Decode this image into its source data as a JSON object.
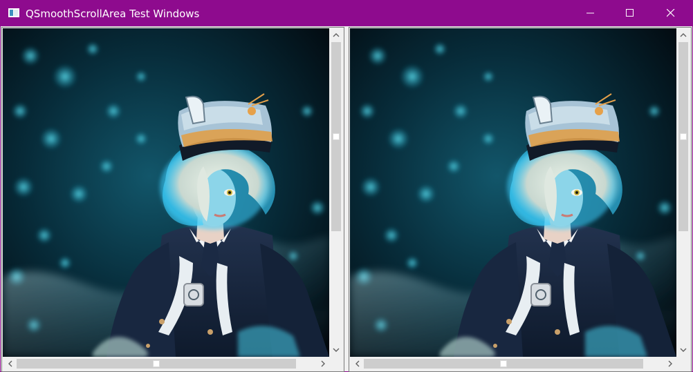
{
  "window": {
    "title": "QSmoothScrollArea Test Windows",
    "title_bar_color": "#8e0b8e",
    "controls": [
      "minimize-icon",
      "maximize-icon",
      "close-icon"
    ]
  },
  "panes": [
    {
      "name": "left-scroll-area",
      "content": "cosplay portrait: white-haired character in navy peaked cap and navy uniform with white tie, teal bokeh and smoke background",
      "vertical_scrollbar": {
        "thumb_fraction": 0.63,
        "position": 0.0
      },
      "horizontal_scrollbar": {
        "thumb_fraction": 0.95,
        "position": 0.0
      }
    },
    {
      "name": "right-scroll-area",
      "content": "cosplay portrait: white-haired character in navy peaked cap and navy uniform with white tie, teal bokeh and smoke background",
      "vertical_scrollbar": {
        "thumb_fraction": 0.63,
        "position": 0.0
      },
      "horizontal_scrollbar": {
        "thumb_fraction": 0.95,
        "position": 0.0
      }
    }
  ],
  "colors": {
    "background_dark": "#020c14",
    "accent_teal": "#1aa6c4",
    "uniform_navy": "#1b2a44",
    "hair": "#dfe6dc",
    "scrollbar_thumb": "#cdcdcd"
  }
}
